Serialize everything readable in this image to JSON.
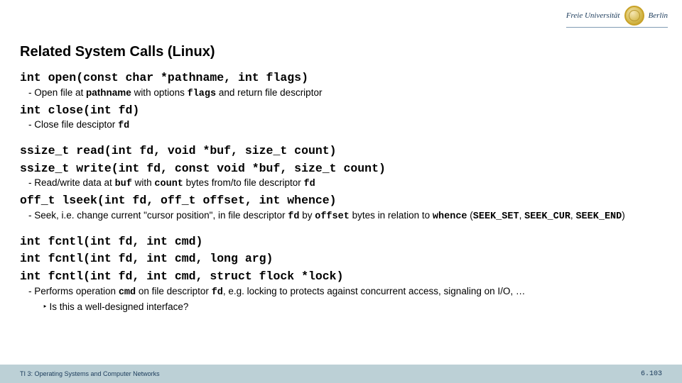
{
  "header": {
    "institution_prefix": "Freie Universität",
    "institution_suffix": "Berlin"
  },
  "title": "Related System Calls (Linux)",
  "calls": {
    "open_sig": "int open(const char *pathname, int flags)",
    "open_desc_1": "Open file at ",
    "open_desc_b1": "pathname",
    "open_desc_2": " with options ",
    "open_desc_m1": "flags",
    "open_desc_3": " and return file descriptor",
    "close_sig": "int close(int fd)",
    "close_desc_1": "Close file desciptor ",
    "close_desc_m1": "fd",
    "read_sig": "ssize_t read(int fd, void *buf, size_t count)",
    "write_sig": "ssize_t write(int fd, const void *buf, size_t count)",
    "rw_desc_1": "Read/write data at ",
    "rw_desc_m1": "buf",
    "rw_desc_2": " with ",
    "rw_desc_m2": "count",
    "rw_desc_3": " bytes from/to file descriptor ",
    "rw_desc_m3": "fd",
    "lseek_sig": "off_t lseek(int fd, off_t offset, int whence)",
    "lseek_desc_1": "Seek, i.e. change current \"cursor position\", in file descriptor ",
    "lseek_desc_m1": "fd",
    "lseek_desc_2": " by ",
    "lseek_desc_m2": "offset",
    "lseek_desc_3": " bytes in relation to ",
    "lseek_desc_m3": "whence",
    "lseek_desc_4": " (",
    "lseek_desc_m4": "SEEK_SET",
    "lseek_desc_5": ", ",
    "lseek_desc_m5": "SEEK_CUR",
    "lseek_desc_6": ", ",
    "lseek_desc_m6": "SEEK_END",
    "lseek_desc_7": ")",
    "fcntl_sig1": "int fcntl(int fd, int cmd)",
    "fcntl_sig2": "int fcntl(int fd, int cmd, long arg)",
    "fcntl_sig3": "int fcntl(int fd, int cmd, struct flock *lock)",
    "fcntl_desc_1": "Performs operation ",
    "fcntl_desc_m1": "cmd",
    "fcntl_desc_2": " on file descriptor ",
    "fcntl_desc_m2": "fd",
    "fcntl_desc_3": ", e.g. locking to protects against concurrent access, signaling on I/O, …",
    "question": "Is this a well-designed interface?"
  },
  "footer": {
    "course": "TI 3: Operating Systems and Computer Networks",
    "page": "6.103"
  }
}
